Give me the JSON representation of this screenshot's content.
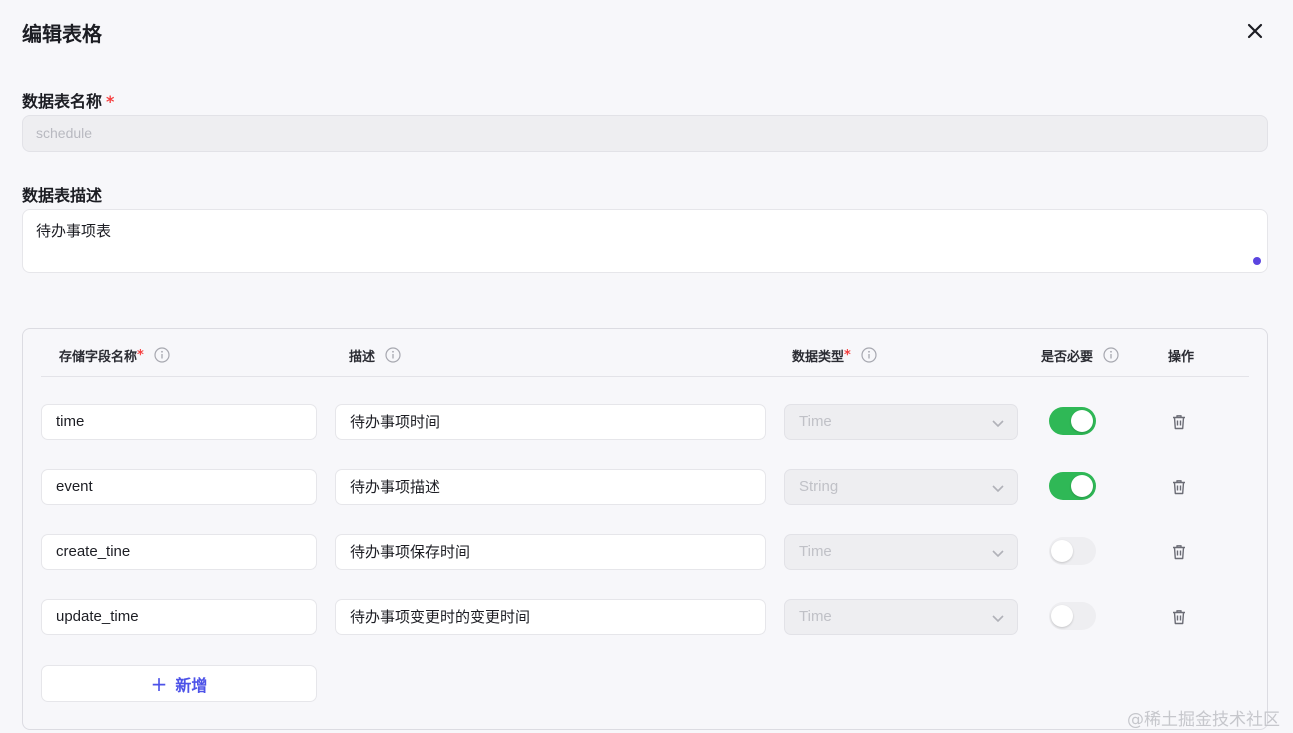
{
  "dialog": {
    "title": "编辑表格",
    "close_icon": "close-icon"
  },
  "name_field": {
    "label": "数据表名称",
    "required_mark": "*",
    "value": "schedule"
  },
  "desc_field": {
    "label": "数据表描述",
    "value": "待办事项表"
  },
  "table": {
    "headers": {
      "field_name": "存储字段名称",
      "field_name_req": "*",
      "description": "描述",
      "data_type": "数据类型",
      "data_type_req": "*",
      "required": "是否必要",
      "actions": "操作"
    },
    "rows": [
      {
        "field": "time",
        "desc": "待办事项时间",
        "type": "Time",
        "required": true
      },
      {
        "field": "event",
        "desc": "待办事项描述",
        "type": "String",
        "required": true
      },
      {
        "field": "create_tine",
        "desc": "待办事项保存时间",
        "type": "Time",
        "required": false
      },
      {
        "field": "update_time",
        "desc": "待办事项变更时的变更时间",
        "type": "Time",
        "required": false
      }
    ],
    "add_label": "新增",
    "add_icon": "+"
  },
  "colors": {
    "accent": "#4d53e8",
    "toggle_on": "#2fb856",
    "required_red": "#f53f3f"
  },
  "watermark": "@稀土掘金技术社区"
}
